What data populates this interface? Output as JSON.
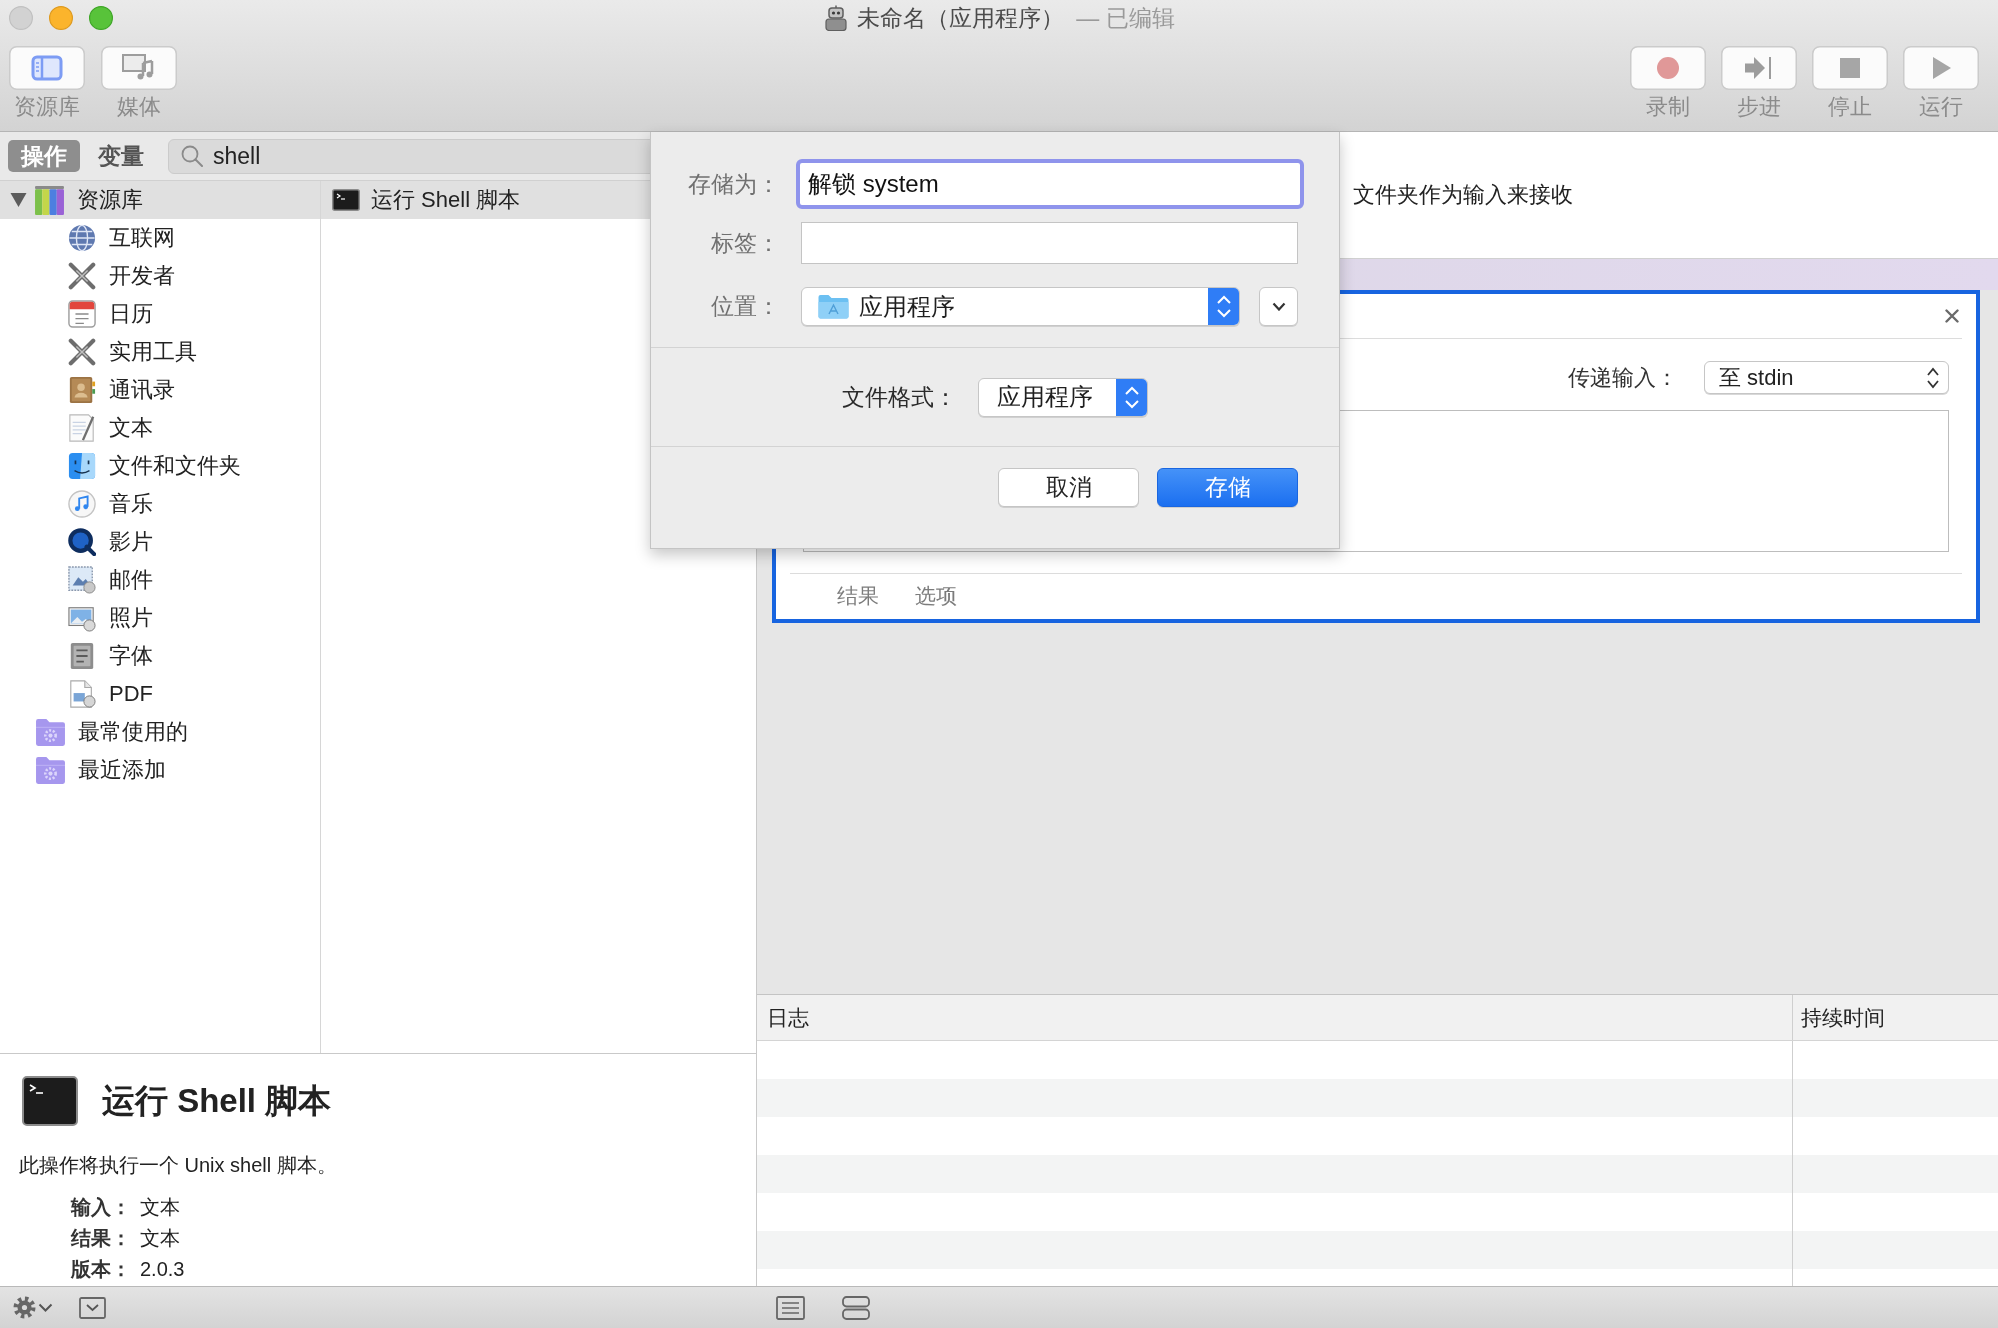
{
  "window": {
    "title": "未命名（应用程序）",
    "subtitle": "— 已编辑",
    "controls": [
      {
        "kind": "close",
        "disabled": true
      },
      {
        "kind": "minimize",
        "disabled": false
      },
      {
        "kind": "zoom",
        "disabled": false
      }
    ]
  },
  "toolbar": {
    "left": [
      {
        "kind": "library",
        "label": "资源库",
        "on": true
      },
      {
        "kind": "media",
        "label": "媒体",
        "on": false
      }
    ],
    "right": [
      {
        "kind": "record",
        "label": "录制"
      },
      {
        "kind": "step",
        "label": "步进"
      },
      {
        "kind": "stop",
        "label": "停止"
      },
      {
        "kind": "run",
        "label": "运行"
      }
    ]
  },
  "library_tabs": [
    {
      "label": "操作",
      "selected": true
    },
    {
      "label": "变量",
      "selected": false
    }
  ],
  "search": {
    "value": "shell"
  },
  "library_tree": [
    {
      "label": "资源库",
      "kind": "library",
      "expanded": true,
      "selected": true,
      "children": [
        {
          "label": "互联网",
          "kind": "globe",
          "selected": false
        },
        {
          "label": "开发者",
          "kind": "tools",
          "selected": false
        },
        {
          "label": "日历",
          "kind": "calendar",
          "selected": false
        },
        {
          "label": "实用工具",
          "kind": "tools",
          "selected": false
        },
        {
          "label": "通讯录",
          "kind": "contacts",
          "selected": false
        },
        {
          "label": "文本",
          "kind": "text",
          "selected": false
        },
        {
          "label": "文件和文件夹",
          "kind": "finder",
          "selected": false
        },
        {
          "label": "音乐",
          "kind": "music",
          "selected": false
        },
        {
          "label": "影片",
          "kind": "movie",
          "selected": false
        },
        {
          "label": "邮件",
          "kind": "mail",
          "selected": false
        },
        {
          "label": "照片",
          "kind": "photos",
          "selected": false
        },
        {
          "label": "字体",
          "kind": "font",
          "selected": false
        },
        {
          "label": "PDF",
          "kind": "pdf",
          "selected": false
        }
      ]
    },
    {
      "label": "最常使用的",
      "kind": "smart-folder",
      "selected": false
    },
    {
      "label": "最近添加",
      "kind": "smart-folder",
      "selected": false
    }
  ],
  "actions": [
    {
      "label": "运行 Shell 脚本",
      "selected": true
    }
  ],
  "description": {
    "title": "运行 Shell 脚本",
    "text": "此操作将执行一个 Unix shell 脚本。",
    "details": [
      {
        "label": "输入：",
        "value": "文本"
      },
      {
        "label": "结果：",
        "value": "文本"
      },
      {
        "label": "版本：",
        "value": "2.0.3"
      }
    ]
  },
  "workflow": {
    "header_text": "文件夹作为输入来接收",
    "action": {
      "pass_input_label": "传递输入：",
      "pass_input_value": "至 stdin",
      "tabs": [
        {
          "label": "结果"
        },
        {
          "label": "选项"
        }
      ]
    }
  },
  "log": {
    "columns": [
      "日志",
      "持续时间"
    ]
  },
  "save_dialog": {
    "fields": [
      {
        "label": "存储为：",
        "value": "解锁 system",
        "focused": true
      },
      {
        "label": "标签：",
        "focused": false
      }
    ],
    "location": {
      "label": "位置：",
      "value": "应用程序",
      "expanded": false
    },
    "file_format": {
      "label": "文件格式：",
      "value": "应用程序"
    },
    "buttons": [
      {
        "label": "取消",
        "kind": "cancel"
      },
      {
        "label": "存储",
        "kind": "default"
      }
    ]
  }
}
